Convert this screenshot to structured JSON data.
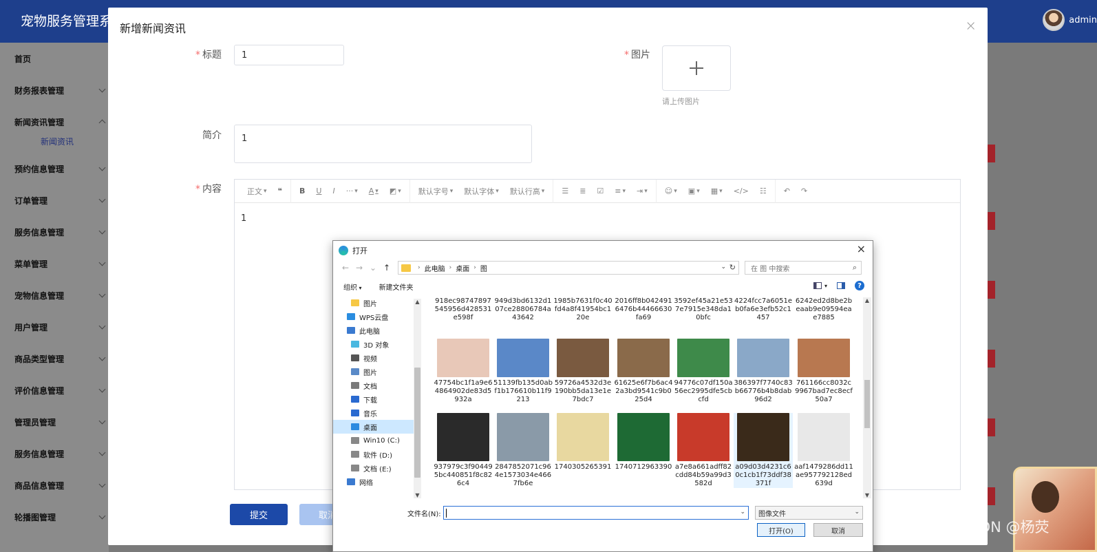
{
  "app": {
    "title": "宠物服务管理系统",
    "user": "admin"
  },
  "sidebar": {
    "items": [
      {
        "label": "首页",
        "expandable": false
      },
      {
        "label": "财务报表管理",
        "expandable": true
      },
      {
        "label": "新闻资讯管理",
        "expandable": true,
        "expanded": true,
        "children": [
          "新闻资讯"
        ]
      },
      {
        "label": "预约信息管理",
        "expandable": true
      },
      {
        "label": "订单管理",
        "expandable": true
      },
      {
        "label": "服务信息管理",
        "expandable": true
      },
      {
        "label": "菜单管理",
        "expandable": true
      },
      {
        "label": "宠物信息管理",
        "expandable": true
      },
      {
        "label": "用户管理",
        "expandable": true
      },
      {
        "label": "商品类型管理",
        "expandable": true
      },
      {
        "label": "评价信息管理",
        "expandable": true
      },
      {
        "label": "管理员管理",
        "expandable": true
      },
      {
        "label": "服务信息管理",
        "expandable": true
      },
      {
        "label": "商品信息管理",
        "expandable": true
      },
      {
        "label": "轮播图管理",
        "expandable": true
      }
    ]
  },
  "modal": {
    "title": "新增新闻资讯",
    "close_glyph": "×",
    "title_label": "标题",
    "title_value": "1",
    "image_label": "图片",
    "upload_tip": "请上传图片",
    "intro_label": "简介",
    "intro_value": "1",
    "content_label": "内容",
    "content_value": "1",
    "toolbar": {
      "paragraph": "正文",
      "font_size": "默认字号",
      "font_family": "默认字体",
      "line_height": "默认行高"
    },
    "submit_label": "提交",
    "cancel_label": "取消"
  },
  "dialog": {
    "title": "打开",
    "close_glyph": "×",
    "breadcrumb": [
      "此电脑",
      "桌面",
      "图"
    ],
    "search_placeholder": "在 图 中搜索",
    "organize_label": "组织",
    "new_folder_label": "新建文件夹",
    "tree": [
      {
        "label": "图片",
        "icon": "folder-icon",
        "indent": 1
      },
      {
        "label": "WPS云盘",
        "icon": "cloud-icon",
        "indent": 0
      },
      {
        "label": "此电脑",
        "icon": "computer-icon",
        "indent": 0
      },
      {
        "label": "3D 对象",
        "icon": "cube-icon",
        "indent": 1
      },
      {
        "label": "视频",
        "icon": "video-icon",
        "indent": 1
      },
      {
        "label": "图片",
        "icon": "pictures-icon",
        "indent": 1
      },
      {
        "label": "文档",
        "icon": "document-icon",
        "indent": 1
      },
      {
        "label": "下载",
        "icon": "download-icon",
        "indent": 1
      },
      {
        "label": "音乐",
        "icon": "music-icon",
        "indent": 1
      },
      {
        "label": "桌面",
        "icon": "desktop-icon",
        "indent": 1,
        "selected": true
      },
      {
        "label": "Win10 (C:)",
        "icon": "drive-icon",
        "indent": 1
      },
      {
        "label": "软件 (D:)",
        "icon": "drive-icon",
        "indent": 1
      },
      {
        "label": "文档 (E:)",
        "icon": "drive-icon",
        "indent": 1
      },
      {
        "label": "网络",
        "icon": "network-icon",
        "indent": 0
      }
    ],
    "files_row1": [
      "918ec98747897545956d428531e598f",
      "949d3bd6132d107ce28806784a43642",
      "1985b7631f0c40fd4a8f41954bc120e",
      "2016ff8b0424916476b44466630fa69",
      "3592ef45a21e537e7915e348da10bfc",
      "4224fcc7a6051eb0fa6e3efb52c1457",
      "6242ed2d8be2beaab9e09594eae7885"
    ],
    "files_row2": [
      {
        "name": "47754bc1f1a9e64864902de83d5932a",
        "color": "#e8c8b8"
      },
      {
        "name": "51139fb135d0abf1b176610b11f9213",
        "color": "#5a88c8"
      },
      {
        "name": "59726a4532d3e190bb5da13e1e7bdc7",
        "color": "#7a5a40"
      },
      {
        "name": "61625e6f7b6ac42a3bd9541c9b025d4",
        "color": "#8a6a4a"
      },
      {
        "name": "94776c07df150a56ec2995dfe5cbcfd",
        "color": "#3e8a4a"
      },
      {
        "name": "386397f7740c83b66776b4b8dab96d2",
        "color": "#8aa8c8"
      },
      {
        "name": "761166cc8032c9967bad7ec8ecf50a7",
        "color": "#b87850"
      }
    ],
    "files_row3": [
      {
        "name": "937979c3f904495bc440851f8c826c4",
        "color": "#2a2a2a"
      },
      {
        "name": "2847852071c964e1573034e4667fb6e",
        "color": "#8a9aa8"
      },
      {
        "name": "1740305265391",
        "color": "#e8d8a0"
      },
      {
        "name": "1740712963390",
        "color": "#1e6a34"
      },
      {
        "name": "a7e8a661adff82cdd84b59a99d3582d",
        "color": "#c83a2a"
      },
      {
        "name": "a09d03d4231c60c1cb1f73ddf38371f",
        "color": "#3a2a1a",
        "selected": true
      },
      {
        "name": "aaf1479286dd11ae957792128ed639d",
        "color": "#e8e8e8"
      }
    ],
    "filename_label": "文件名(N):",
    "filename_value": "",
    "filetype_value": "图像文件",
    "open_label": "打开(O)",
    "cancel_label": "取消"
  },
  "watermark": "CSDN @杨荧"
}
